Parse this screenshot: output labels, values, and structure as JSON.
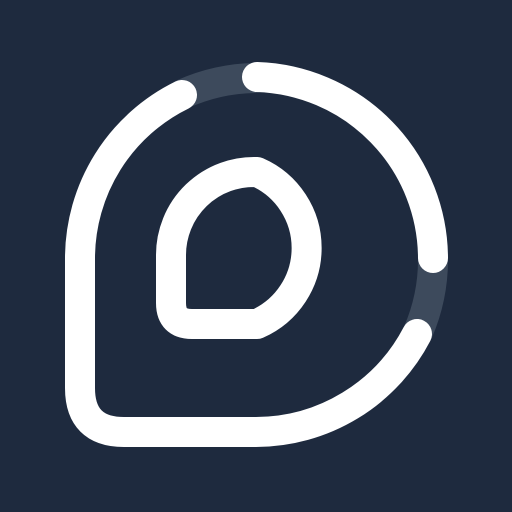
{
  "icon": {
    "name": "linebit-style-logo-icon",
    "background_color": "#1e2a3e",
    "stroke_color": "#ffffff",
    "accent_track_color": "#3d4a5c"
  }
}
